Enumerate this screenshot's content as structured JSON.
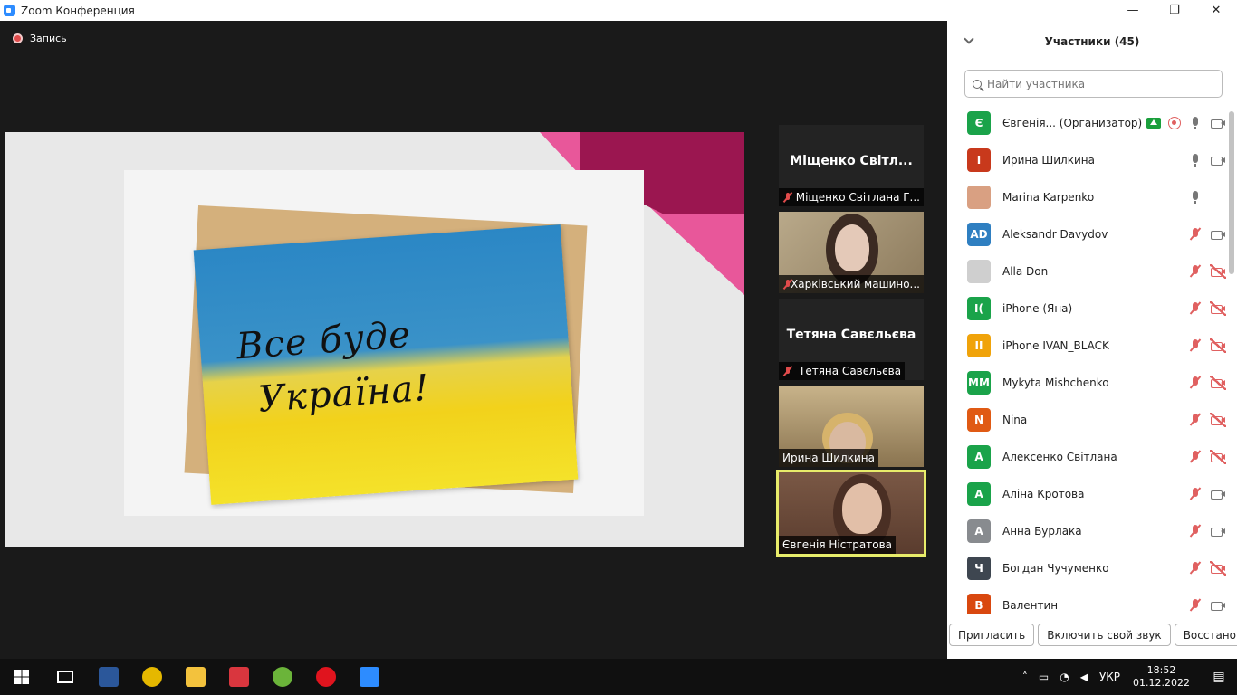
{
  "window": {
    "title": "Zoom Конференция",
    "minimize": "—",
    "restore": "❐",
    "close": "✕"
  },
  "recording": {
    "label": "Запись"
  },
  "shared_card": {
    "line1": "Все буде",
    "line2": "Україна!"
  },
  "tiles": [
    {
      "big_name": "Міщенко Світл...",
      "caption": "Міщенко Світлана Г...",
      "muted": true,
      "video": false
    },
    {
      "caption": "Харківський машино...",
      "muted": true,
      "video": true
    },
    {
      "big_name": "Тетяна Савєльєва",
      "caption": "Тетяна Савєльєва",
      "muted": true,
      "video": false
    },
    {
      "caption": "Ирина Шилкина",
      "muted": false,
      "video": true
    },
    {
      "caption": "Євгенія Ністратова",
      "muted": false,
      "video": true,
      "active": true
    }
  ],
  "panel": {
    "title": "Участники (45)",
    "search_placeholder": "Найти участника",
    "participants": [
      {
        "initials": "Є",
        "color": "#1aa34a",
        "name": "Євгенія... (Организатор)",
        "share": true,
        "rec": true,
        "mic": "on",
        "cam": "on"
      },
      {
        "initials": "I",
        "color": "#c8391c",
        "name": "Ирина Шилкина",
        "mic": "on",
        "cam": "on"
      },
      {
        "initials": "",
        "color": "#d9a082",
        "name": "Marina Karpenko",
        "photo": true,
        "mic": "on",
        "cam": "none"
      },
      {
        "initials": "AD",
        "color": "#2f7fc1",
        "name": "Aleksandr Davydov",
        "mic": "muted",
        "cam": "on"
      },
      {
        "initials": "",
        "color": "#cfcfcf",
        "name": "Alla Don",
        "photo": true,
        "mic": "muted",
        "cam": "off"
      },
      {
        "initials": "I(",
        "color": "#1aa34a",
        "name": "iPhone (Яна)",
        "mic": "muted",
        "cam": "off"
      },
      {
        "initials": "II",
        "color": "#f0a30a",
        "name": "iPhone IVAN_BLACK",
        "mic": "muted",
        "cam": "off"
      },
      {
        "initials": "MM",
        "color": "#1aa34a",
        "name": "Mykyta Mishchenko",
        "mic": "muted",
        "cam": "off"
      },
      {
        "initials": "N",
        "color": "#e05a14",
        "name": "Nina",
        "mic": "muted",
        "cam": "off"
      },
      {
        "initials": "A",
        "color": "#1aa34a",
        "name": "Алексенко Світлана",
        "mic": "muted",
        "cam": "off"
      },
      {
        "initials": "A",
        "color": "#1aa34a",
        "name": "Аліна Кротова",
        "mic": "muted",
        "cam": "on"
      },
      {
        "initials": "A",
        "color": "#888b8f",
        "name": "Анна Бурлака",
        "mic": "muted",
        "cam": "on"
      },
      {
        "initials": "Ч",
        "color": "#3e4650",
        "name": "Богдан Чучуменко",
        "mic": "muted",
        "cam": "off"
      },
      {
        "initials": "B",
        "color": "#d9480f",
        "name": "Валентин",
        "mic": "muted",
        "cam": "on"
      }
    ],
    "footer": {
      "invite": "Пригласить",
      "unmute": "Включить свой звук",
      "reclaim": "Восстановить"
    }
  },
  "taskbar": {
    "apps": [
      {
        "name": "word",
        "color": "#2b579a"
      },
      {
        "name": "chrome",
        "color": "#e5b800"
      },
      {
        "name": "explorer",
        "color": "#f3c23d"
      },
      {
        "name": "presentation",
        "color": "#d9363e"
      },
      {
        "name": "utorrent",
        "color": "#6bb43a"
      },
      {
        "name": "opera",
        "color": "#e0141e"
      },
      {
        "name": "zoom",
        "color": "#2d8cff"
      }
    ],
    "lang": "УКР",
    "time": "18:52",
    "date": "01.12.2022"
  }
}
